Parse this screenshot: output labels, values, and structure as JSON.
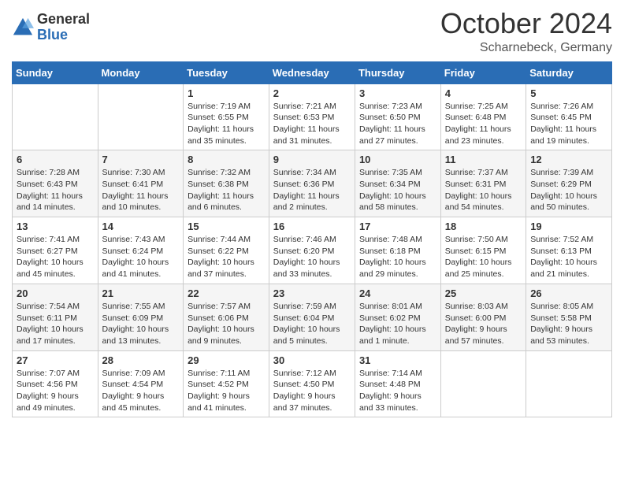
{
  "header": {
    "logo_general": "General",
    "logo_blue": "Blue",
    "month": "October 2024",
    "location": "Scharnebeck, Germany"
  },
  "days_of_week": [
    "Sunday",
    "Monday",
    "Tuesday",
    "Wednesday",
    "Thursday",
    "Friday",
    "Saturday"
  ],
  "weeks": [
    [
      {
        "day": "",
        "info": ""
      },
      {
        "day": "",
        "info": ""
      },
      {
        "day": "1",
        "info": "Sunrise: 7:19 AM\nSunset: 6:55 PM\nDaylight: 11 hours and 35 minutes."
      },
      {
        "day": "2",
        "info": "Sunrise: 7:21 AM\nSunset: 6:53 PM\nDaylight: 11 hours and 31 minutes."
      },
      {
        "day": "3",
        "info": "Sunrise: 7:23 AM\nSunset: 6:50 PM\nDaylight: 11 hours and 27 minutes."
      },
      {
        "day": "4",
        "info": "Sunrise: 7:25 AM\nSunset: 6:48 PM\nDaylight: 11 hours and 23 minutes."
      },
      {
        "day": "5",
        "info": "Sunrise: 7:26 AM\nSunset: 6:45 PM\nDaylight: 11 hours and 19 minutes."
      }
    ],
    [
      {
        "day": "6",
        "info": "Sunrise: 7:28 AM\nSunset: 6:43 PM\nDaylight: 11 hours and 14 minutes."
      },
      {
        "day": "7",
        "info": "Sunrise: 7:30 AM\nSunset: 6:41 PM\nDaylight: 11 hours and 10 minutes."
      },
      {
        "day": "8",
        "info": "Sunrise: 7:32 AM\nSunset: 6:38 PM\nDaylight: 11 hours and 6 minutes."
      },
      {
        "day": "9",
        "info": "Sunrise: 7:34 AM\nSunset: 6:36 PM\nDaylight: 11 hours and 2 minutes."
      },
      {
        "day": "10",
        "info": "Sunrise: 7:35 AM\nSunset: 6:34 PM\nDaylight: 10 hours and 58 minutes."
      },
      {
        "day": "11",
        "info": "Sunrise: 7:37 AM\nSunset: 6:31 PM\nDaylight: 10 hours and 54 minutes."
      },
      {
        "day": "12",
        "info": "Sunrise: 7:39 AM\nSunset: 6:29 PM\nDaylight: 10 hours and 50 minutes."
      }
    ],
    [
      {
        "day": "13",
        "info": "Sunrise: 7:41 AM\nSunset: 6:27 PM\nDaylight: 10 hours and 45 minutes."
      },
      {
        "day": "14",
        "info": "Sunrise: 7:43 AM\nSunset: 6:24 PM\nDaylight: 10 hours and 41 minutes."
      },
      {
        "day": "15",
        "info": "Sunrise: 7:44 AM\nSunset: 6:22 PM\nDaylight: 10 hours and 37 minutes."
      },
      {
        "day": "16",
        "info": "Sunrise: 7:46 AM\nSunset: 6:20 PM\nDaylight: 10 hours and 33 minutes."
      },
      {
        "day": "17",
        "info": "Sunrise: 7:48 AM\nSunset: 6:18 PM\nDaylight: 10 hours and 29 minutes."
      },
      {
        "day": "18",
        "info": "Sunrise: 7:50 AM\nSunset: 6:15 PM\nDaylight: 10 hours and 25 minutes."
      },
      {
        "day": "19",
        "info": "Sunrise: 7:52 AM\nSunset: 6:13 PM\nDaylight: 10 hours and 21 minutes."
      }
    ],
    [
      {
        "day": "20",
        "info": "Sunrise: 7:54 AM\nSunset: 6:11 PM\nDaylight: 10 hours and 17 minutes."
      },
      {
        "day": "21",
        "info": "Sunrise: 7:55 AM\nSunset: 6:09 PM\nDaylight: 10 hours and 13 minutes."
      },
      {
        "day": "22",
        "info": "Sunrise: 7:57 AM\nSunset: 6:06 PM\nDaylight: 10 hours and 9 minutes."
      },
      {
        "day": "23",
        "info": "Sunrise: 7:59 AM\nSunset: 6:04 PM\nDaylight: 10 hours and 5 minutes."
      },
      {
        "day": "24",
        "info": "Sunrise: 8:01 AM\nSunset: 6:02 PM\nDaylight: 10 hours and 1 minute."
      },
      {
        "day": "25",
        "info": "Sunrise: 8:03 AM\nSunset: 6:00 PM\nDaylight: 9 hours and 57 minutes."
      },
      {
        "day": "26",
        "info": "Sunrise: 8:05 AM\nSunset: 5:58 PM\nDaylight: 9 hours and 53 minutes."
      }
    ],
    [
      {
        "day": "27",
        "info": "Sunrise: 7:07 AM\nSunset: 4:56 PM\nDaylight: 9 hours and 49 minutes."
      },
      {
        "day": "28",
        "info": "Sunrise: 7:09 AM\nSunset: 4:54 PM\nDaylight: 9 hours and 45 minutes."
      },
      {
        "day": "29",
        "info": "Sunrise: 7:11 AM\nSunset: 4:52 PM\nDaylight: 9 hours and 41 minutes."
      },
      {
        "day": "30",
        "info": "Sunrise: 7:12 AM\nSunset: 4:50 PM\nDaylight: 9 hours and 37 minutes."
      },
      {
        "day": "31",
        "info": "Sunrise: 7:14 AM\nSunset: 4:48 PM\nDaylight: 9 hours and 33 minutes."
      },
      {
        "day": "",
        "info": ""
      },
      {
        "day": "",
        "info": ""
      }
    ]
  ]
}
